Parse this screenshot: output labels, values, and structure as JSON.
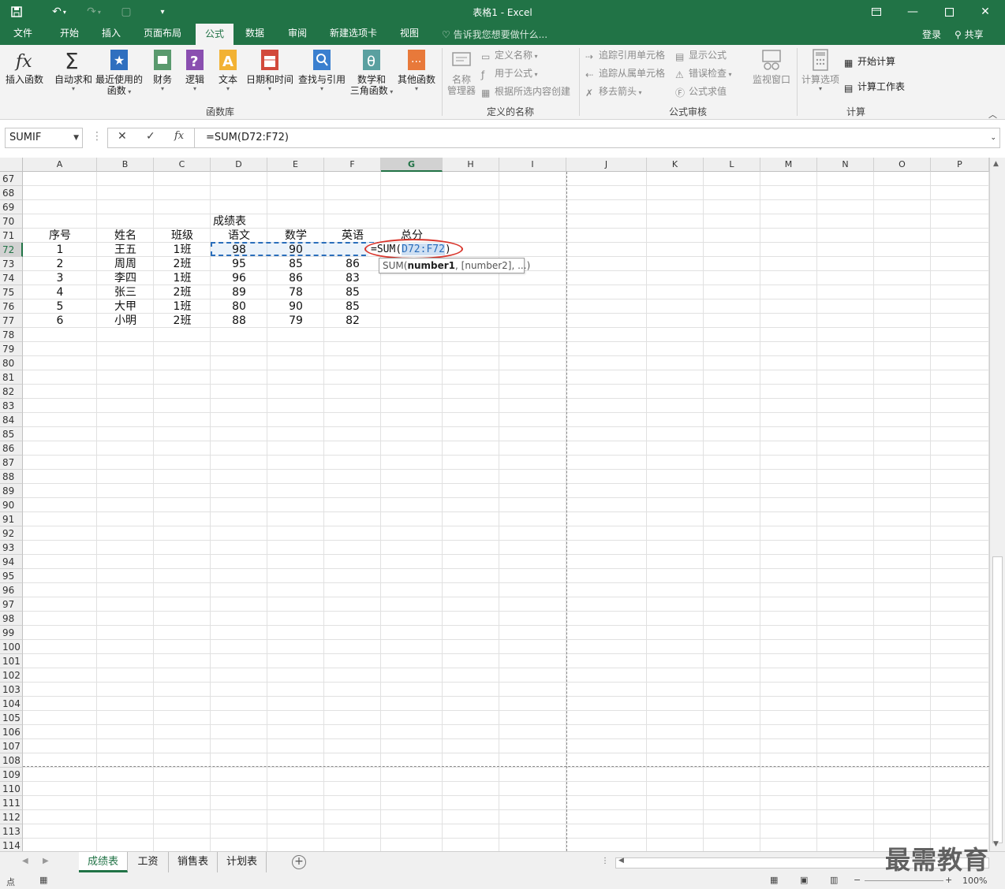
{
  "window": {
    "title": "表格1 - Excel",
    "controls": [
      "ribbon-display",
      "minimize",
      "maximize",
      "close"
    ]
  },
  "tabs": [
    "文件",
    "开始",
    "插入",
    "页面布局",
    "公式",
    "数据",
    "审阅",
    "新建选项卡",
    "视图"
  ],
  "active_tab": "公式",
  "tell_me": "告诉我您想要做什么...",
  "account": {
    "login": "登录",
    "share": "共享"
  },
  "ribbon": {
    "function_library": {
      "group_label": "函数库",
      "insert_function": "插入函数",
      "autosum": "自动求和",
      "recent_l1": "最近使用的",
      "recent_l2": "函数",
      "financial": "财务",
      "logical": "逻辑",
      "text": "文本",
      "datetime": "日期和时间",
      "lookup": "查找与引用",
      "math_l1": "数学和",
      "math_l2": "三角函数",
      "more": "其他函数"
    },
    "defined_names": {
      "group_label": "定义的名称",
      "name_manager_l1": "名称",
      "name_manager_l2": "管理器",
      "define_name": "定义名称",
      "use_in_formula": "用于公式",
      "create_from_selection": "根据所选内容创建"
    },
    "formula_auditing": {
      "group_label": "公式审核",
      "trace_precedents": "追踪引用单元格",
      "trace_dependents": "追踪从属单元格",
      "remove_arrows": "移去箭头",
      "show_formulas": "显示公式",
      "error_checking": "错误检查",
      "evaluate_formula": "公式求值",
      "watch_window": "监视窗口"
    },
    "calculation": {
      "group_label": "计算",
      "calc_options": "计算选项",
      "calc_now": "开始计算",
      "calc_sheet": "计算工作表"
    }
  },
  "formula_bar": {
    "name_box": "SUMIF",
    "cancel": "✕",
    "enter": "✓",
    "fx": "fx",
    "formula": "=SUM(D72:F72)"
  },
  "columns": [
    "A",
    "B",
    "C",
    "D",
    "E",
    "F",
    "G",
    "H",
    "I",
    "J",
    "K",
    "L",
    "M",
    "N",
    "O",
    "P"
  ],
  "selected_column": "G",
  "rows": [
    "67",
    "68",
    "69",
    "70",
    "71",
    "72",
    "73",
    "74",
    "75",
    "76",
    "77",
    "78",
    "79",
    "80",
    "81",
    "82",
    "83",
    "84",
    "85",
    "86",
    "87",
    "88",
    "89",
    "90",
    "91",
    "92",
    "93",
    "94",
    "95",
    "96",
    "97",
    "98",
    "99",
    "100",
    "101",
    "102",
    "103",
    "104",
    "105",
    "106",
    "107",
    "108",
    "109",
    "110",
    "111",
    "112",
    "113",
    "114"
  ],
  "selected_row": "72",
  "sheet": {
    "title": "成绩表",
    "headers": [
      "序号",
      "姓名",
      "班级",
      "语文",
      "数学",
      "英语",
      "总分"
    ],
    "records": [
      [
        "1",
        "王五",
        "1班",
        "98",
        "90",
        ""
      ],
      [
        "2",
        "周周",
        "2班",
        "95",
        "85",
        "86"
      ],
      [
        "3",
        "李四",
        "1班",
        "96",
        "86",
        "83"
      ],
      [
        "4",
        "张三",
        "2班",
        "89",
        "78",
        "85"
      ],
      [
        "5",
        "大甲",
        "1班",
        "80",
        "90",
        "85"
      ],
      [
        "6",
        "小明",
        "2班",
        "88",
        "79",
        "82"
      ]
    ],
    "editing_formula": {
      "prefix": "=SUM(",
      "reference": "D72:F72",
      "suffix": ")"
    },
    "tooltip": {
      "fn": "SUM(",
      "arg1": "number1",
      "rest": ", [number2], ...)"
    }
  },
  "sheet_tabs": [
    "成绩表",
    "工资",
    "销售表",
    "计划表"
  ],
  "active_sheet": "成绩表",
  "status": {
    "mode": "点",
    "zoom": "100%"
  },
  "watermark": "最需教育",
  "colors": {
    "excel_green": "#217346",
    "reference_blue": "#2a6ebb",
    "highlight_red": "#d9352b"
  }
}
